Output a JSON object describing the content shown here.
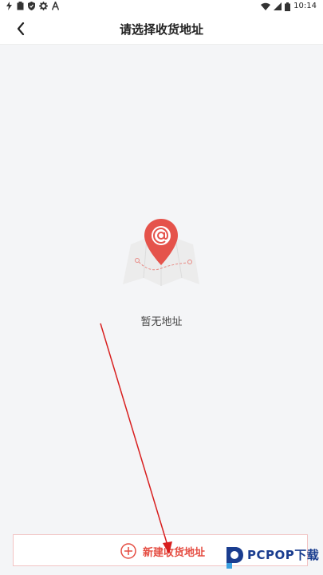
{
  "status_bar": {
    "time": "10:14",
    "left_icons": [
      "flash-icon",
      "clipboard-icon",
      "shield-icon",
      "gear-icon",
      "text-a-icon"
    ],
    "right_icons": [
      "wifi-icon",
      "signal-icon",
      "battery-icon"
    ]
  },
  "header": {
    "title": "请选择收货地址",
    "back_icon": "chevron-left-icon"
  },
  "main": {
    "empty_text": "暂无地址",
    "illustration_icon": "map-pin-icon"
  },
  "footer": {
    "add_label": "新建收货地址",
    "add_icon": "plus-circle-icon"
  },
  "watermark": {
    "text": "PCPOP下载"
  },
  "colors": {
    "accent": "#e54d42",
    "background": "#f4f5f7",
    "annotation_arrow": "#d81e1e"
  }
}
